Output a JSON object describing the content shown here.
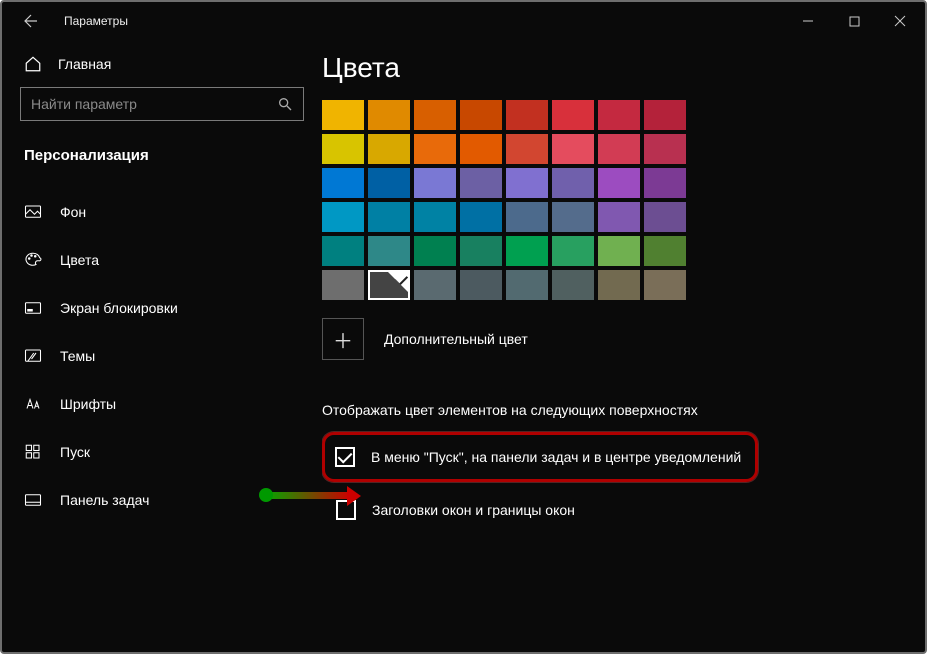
{
  "window": {
    "title": "Параметры"
  },
  "sidebar": {
    "home": "Главная",
    "search_placeholder": "Найти параметр",
    "section": "Персонализация",
    "items": [
      {
        "label": "Фон"
      },
      {
        "label": "Цвета"
      },
      {
        "label": "Экран блокировки"
      },
      {
        "label": "Темы"
      },
      {
        "label": "Шрифты"
      },
      {
        "label": "Пуск"
      },
      {
        "label": "Панель задач"
      }
    ]
  },
  "main": {
    "heading": "Цвета",
    "swatches": [
      [
        "#f0b400",
        "#e08a00",
        "#d85f00",
        "#c84800",
        "#c23020",
        "#d8303b",
        "#c42940",
        "#b4223a"
      ],
      [
        "#d8c400",
        "#d8a800",
        "#e86a0a",
        "#e25a00",
        "#d24630",
        "#e44c5e",
        "#d23c54",
        "#b83050"
      ],
      [
        "#0078d4",
        "#0060a4",
        "#7a78d4",
        "#6c60a4",
        "#8070d0",
        "#7060ac",
        "#9c4cc0",
        "#7c3a94"
      ],
      [
        "#0098c4",
        "#0080a4",
        "#0082a4",
        "#0070a4",
        "#4c6a8c",
        "#546c8c",
        "#8058b0",
        "#6c4e92"
      ],
      [
        "#008080",
        "#2e8888",
        "#008050",
        "#188060",
        "#00a050",
        "#28a060",
        "#70b050",
        "#508030"
      ],
      [
        "#6e6e6e",
        "#444444",
        "#5a6a70",
        "#4c5a60",
        "#526a70",
        "#506060",
        "#726a50",
        "#7a6e58"
      ]
    ],
    "selected": {
      "row": 5,
      "col": 1
    },
    "add_color": "Дополнительный цвет",
    "surfaces_heading": "Отображать цвет элементов на следующих поверхностях",
    "check_start": "В меню \"Пуск\", на панели задач и в центре уведомлений",
    "check_titlebars": "Заголовки окон и границы окон"
  }
}
